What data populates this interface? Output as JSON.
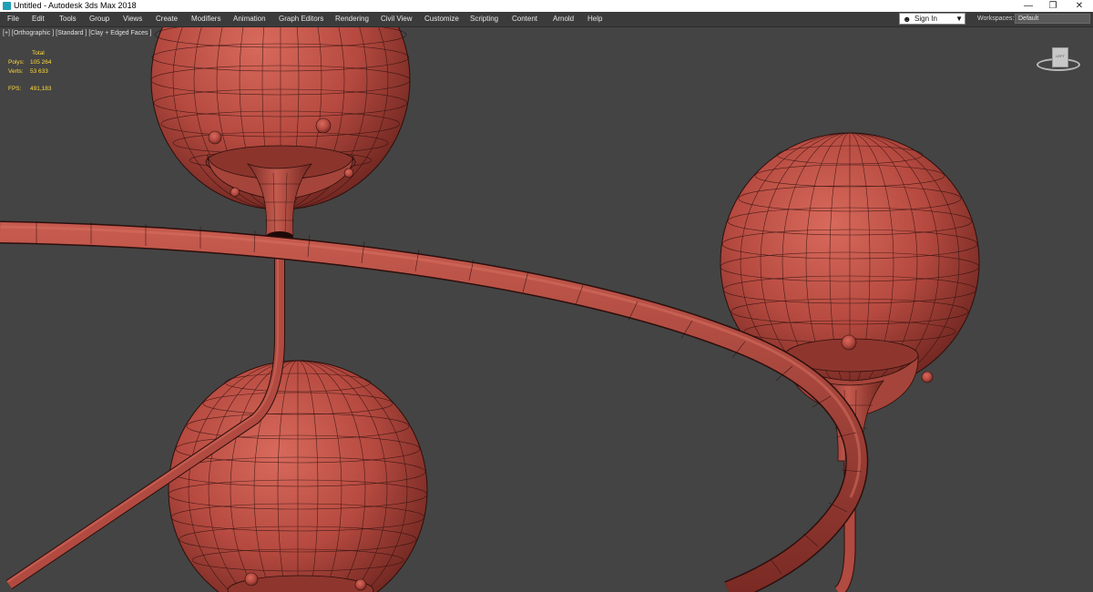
{
  "window": {
    "title": "Untitled - Autodesk 3ds Max 2018",
    "minimize": "—",
    "restore": "❐",
    "close": "✕"
  },
  "menu": [
    "File",
    "Edit",
    "Tools",
    "Group",
    "Views",
    "Create",
    "Modifiers",
    "Animation",
    "Graph Editors",
    "Rendering",
    "Civil View",
    "Customize",
    "Scripting",
    "Content",
    "Arnold",
    "Help"
  ],
  "account": {
    "sign_in_label": "Sign In",
    "icon": "user-icon"
  },
  "workspaces": {
    "label": "Workspaces:",
    "value": "Default"
  },
  "viewport": {
    "label": "[+] [Orthographic ] [Standard ] [Clay + Edged Faces ]",
    "stats": {
      "header": "Total",
      "polys_label": "Polys:",
      "polys_value": "105 264",
      "verts_label": "Verts:",
      "verts_value": "53 633",
      "fps_label": "FPS:",
      "fps_value": "491,183"
    },
    "viewcube_face": "LEFT"
  },
  "colors": {
    "clay": "#b64a40",
    "clay_highlight": "#d86a5c",
    "clay_shadow": "#6e2620",
    "edge": "#2c0f0c",
    "viewport_bg": "#444444",
    "stats_text": "#ffd93b"
  }
}
